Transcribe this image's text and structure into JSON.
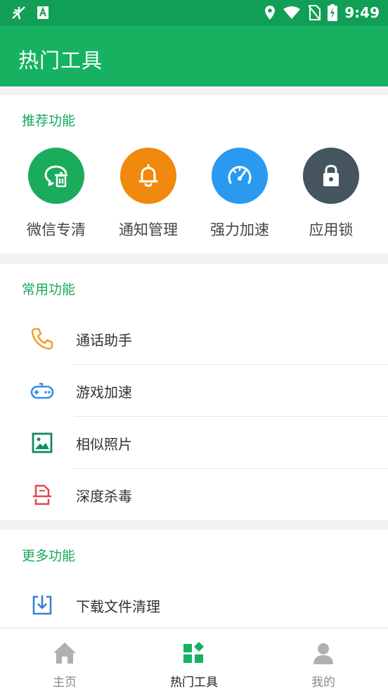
{
  "status_bar": {
    "time": "9:49"
  },
  "app_bar": {
    "title": "热门工具"
  },
  "recommended": {
    "title": "推荐功能",
    "items": [
      {
        "label": "微信专清",
        "icon": "wechat-clean-icon",
        "color": "#1aac5c"
      },
      {
        "label": "通知管理",
        "icon": "bell-icon",
        "color": "#f0890e"
      },
      {
        "label": "强力加速",
        "icon": "speedometer-icon",
        "color": "#2a9af0"
      },
      {
        "label": "应用锁",
        "icon": "lock-icon",
        "color": "#445560"
      }
    ]
  },
  "common": {
    "title": "常用功能",
    "items": [
      {
        "label": "通话助手",
        "icon": "phone-icon",
        "color": "#f0a030"
      },
      {
        "label": "游戏加速",
        "icon": "gamepad-icon",
        "color": "#3a8ee6"
      },
      {
        "label": "相似照片",
        "icon": "image-icon",
        "color": "#138a5e"
      },
      {
        "label": "深度杀毒",
        "icon": "antivirus-icon",
        "color": "#e04848"
      }
    ]
  },
  "more": {
    "title": "更多功能",
    "items": [
      {
        "label": "下载文件清理",
        "icon": "download-icon",
        "color": "#3a7fd0"
      }
    ]
  },
  "bottom_nav": {
    "items": [
      {
        "label": "主页",
        "icon": "home-icon",
        "active": false
      },
      {
        "label": "热门工具",
        "icon": "tools-icon",
        "active": true
      },
      {
        "label": "我的",
        "icon": "profile-icon",
        "active": false
      }
    ]
  },
  "colors": {
    "primary": "#16b262",
    "status_bar": "#119f55",
    "section_title": "#17a85d"
  }
}
